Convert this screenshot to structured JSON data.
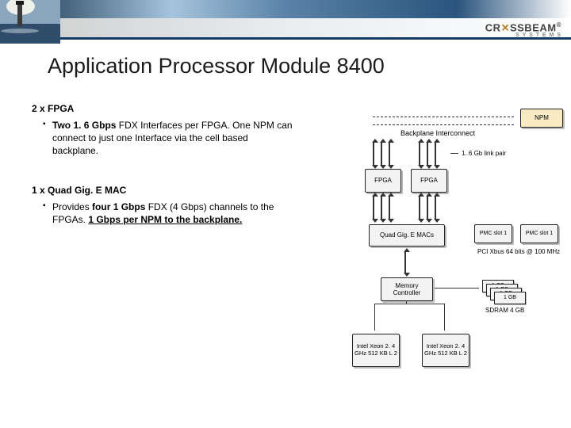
{
  "header": {
    "brand_left": "CR",
    "brand_x": "✕",
    "brand_right": "SSBEAM",
    "brand_sub": "S Y S T E M S"
  },
  "title": "Application Processor Module  8400",
  "section1": {
    "heading": "2 x FPGA",
    "bullet_pre": "Two 1. 6 Gbps",
    "bullet_mid": " FDX          Interfaces per FPGA. One NPM can connect to just one Interface via the cell based backplane."
  },
  "section2": {
    "heading": "1 x Quad Gig. E MAC",
    "bullet_pre": "Provides ",
    "bullet_bold": "four 1 Gbps",
    "bullet_mid": " FDX                (4 Gbps) channels to the FPGAs. ",
    "bullet_ul": "1 Gbps per NPM to the backplane."
  },
  "diagram": {
    "npm": "NPM",
    "backplane": "Backplane Interconnect",
    "link_pair": "1. 6 Gb link pair",
    "fpga": "FPGA",
    "gige": "Quad Gig. E MACs",
    "pmc": "PMC slot 1",
    "pci": "PCI Xbus 64 bits @ 100 MHz",
    "memctl": "Memory Controller",
    "cpu": "Intel Xeon 2. 4 GHz 512 KB L 2",
    "ram": "1 GB",
    "sdram": "SDRAM 4 GB"
  }
}
